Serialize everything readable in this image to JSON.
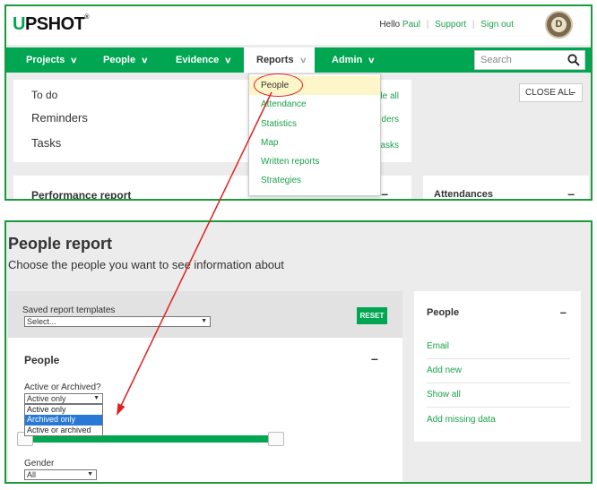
{
  "header": {
    "logo_mark": "U",
    "logo_rest": "PSHOT",
    "logo_reg": "®",
    "hello": "Hello",
    "user": "Paul",
    "support": "Support",
    "sign_out": "Sign out",
    "badge_letter": "D"
  },
  "nav": {
    "projects": "Projects",
    "people": "People",
    "evidence": "Evidence",
    "reports": "Reports",
    "admin": "Admin",
    "search_placeholder": "Search"
  },
  "reports_menu": {
    "items": [
      "People",
      "Attendance",
      "Statistics",
      "Map",
      "Written reports",
      "Strategies"
    ],
    "highlighted": "People"
  },
  "dashboard": {
    "todo": "To do",
    "reminders": "Reminders",
    "tasks": "Tasks",
    "todo_link": "de all",
    "reminders_link": "nders",
    "tasks_link": "tasks",
    "close_all": "CLOSE ALL",
    "close_minus": "–",
    "performance_report": "Performance report",
    "attendances": "Attendances",
    "minus": "–"
  },
  "people_report": {
    "title": "People report",
    "subtitle": "Choose the people you want to see information about",
    "saved_templates_label": "Saved report templates",
    "saved_templates_value": "Select...",
    "reset": "RESET",
    "section_title": "People",
    "section_minus": "–",
    "active_label": "Active or Archived?",
    "active_value": "Active only",
    "active_options": [
      "Active only",
      "Archived only",
      "Active or archived"
    ],
    "active_selected": "Archived only",
    "gender_label": "Gender",
    "gender_value": "All"
  },
  "side_panel": {
    "title": "People",
    "minus": "–",
    "links": [
      "Email",
      "Add new",
      "Show all",
      "Add missing data"
    ]
  },
  "colors": {
    "brand_green": "#00a651",
    "link_green": "#1aa24a",
    "annotation_red": "#e02020",
    "highlight_yellow": "#fdf6c8",
    "selection_blue": "#2a78d6"
  },
  "icons": {
    "search": "search-icon",
    "chevron": "chevron-down-icon"
  }
}
